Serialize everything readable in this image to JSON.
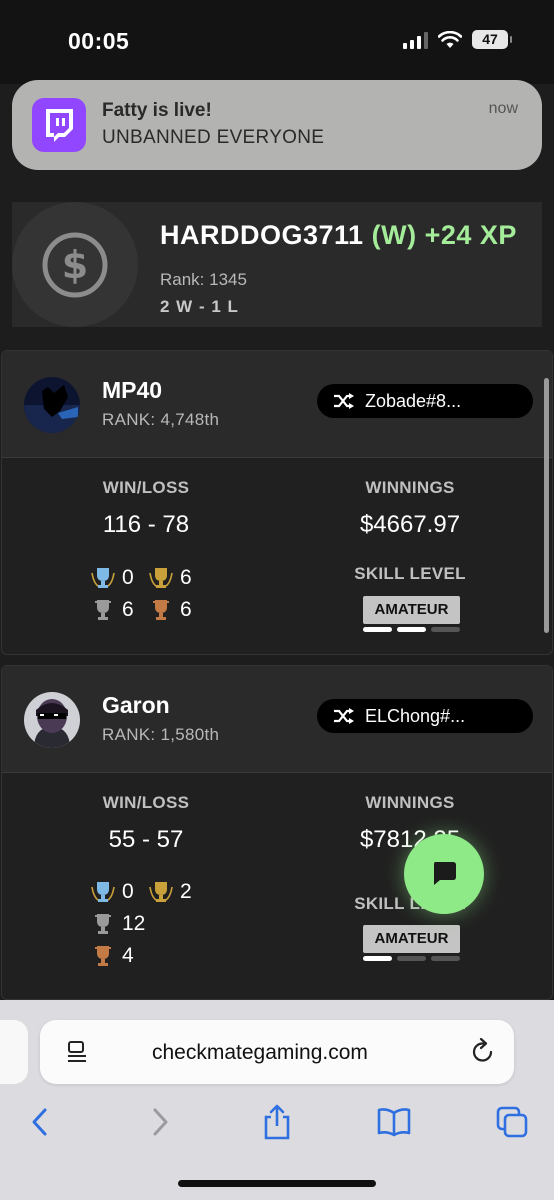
{
  "status_bar": {
    "time": "00:05",
    "battery": "47"
  },
  "notification": {
    "title": "Fatty is live!",
    "body": "UNBANNED EVERYONE",
    "time": "now",
    "app_icon": "twitch-icon"
  },
  "xp_card": {
    "name": "HARDDOG3711",
    "result": "(W)",
    "xp": "+24 XP",
    "rank": "Rank: 1345",
    "record": "2 W - 1 L"
  },
  "labels": {
    "win_loss": "WIN/LOSS",
    "winnings": "WINNINGS",
    "skill_level": "SKILL LEVEL"
  },
  "players": [
    {
      "name": "MP40",
      "rank": "RANK: 4,748th",
      "opponent": "Zobade#8...",
      "win_loss": "116 - 78",
      "winnings": "$4667.97",
      "trophies": {
        "platinum": "0",
        "gold": "6",
        "silver": "6",
        "bronze": "6"
      },
      "skill": "AMATEUR",
      "skill_level": 2
    },
    {
      "name": "Garon",
      "rank": "RANK: 1,580th",
      "opponent": "ELChong#...",
      "win_loss": "55 - 57",
      "winnings": "$7812.25",
      "trophies": {
        "platinum": "0",
        "gold": "2",
        "silver": "12",
        "bronze": "4"
      },
      "skill": "AMATEUR",
      "skill_level": 1
    }
  ],
  "browser": {
    "url": "checkmategaming.com"
  },
  "colors": {
    "accent_green": "#a5ec9a",
    "fab_green": "#8ee987",
    "twitch_purple": "#9146ff",
    "ios_blue": "#2f6fe0"
  }
}
